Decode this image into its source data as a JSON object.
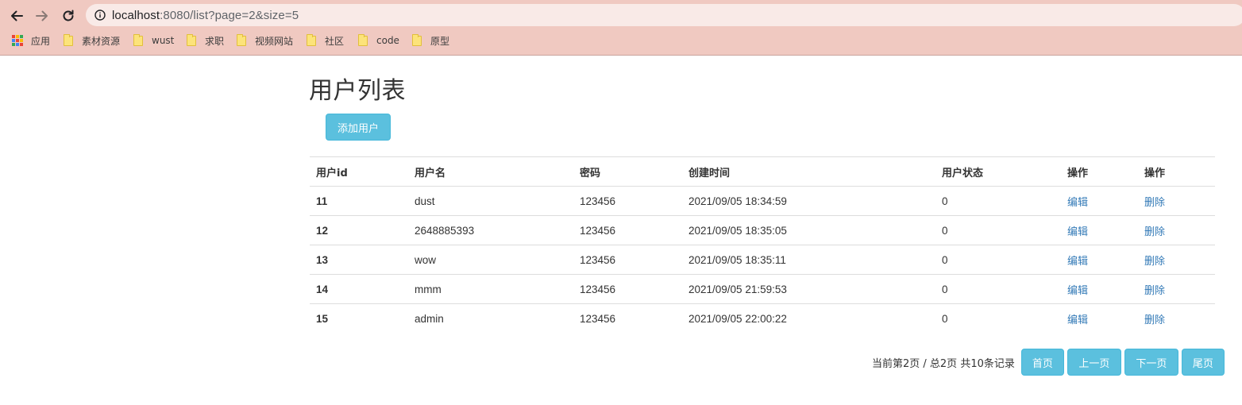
{
  "browser": {
    "url_host": "localhost",
    "url_path": ":8080/list?page=2&size=5",
    "bookmarks": [
      {
        "label": "应用",
        "icon": "apps-icon"
      },
      {
        "label": "素材资源",
        "icon": "folder-icon"
      },
      {
        "label": "wust",
        "icon": "folder-icon"
      },
      {
        "label": "求职",
        "icon": "folder-icon"
      },
      {
        "label": "视频网站",
        "icon": "folder-icon"
      },
      {
        "label": "社区",
        "icon": "folder-icon"
      },
      {
        "label": "code",
        "icon": "folder-icon"
      },
      {
        "label": "原型",
        "icon": "folder-icon"
      }
    ]
  },
  "page": {
    "title": "用户列表",
    "add_button": "添加用户"
  },
  "table": {
    "headers": [
      "用户id",
      "用户名",
      "密码",
      "创建时间",
      "用户状态",
      "操作",
      "操作"
    ],
    "rows": [
      {
        "id": "11",
        "username": "dust",
        "password": "123456",
        "created": "2021/09/05 18:34:59",
        "status": "0",
        "edit": "编辑",
        "delete": "删除"
      },
      {
        "id": "12",
        "username": "2648885393",
        "password": "123456",
        "created": "2021/09/05 18:35:05",
        "status": "0",
        "edit": "编辑",
        "delete": "删除"
      },
      {
        "id": "13",
        "username": "wow",
        "password": "123456",
        "created": "2021/09/05 18:35:11",
        "status": "0",
        "edit": "编辑",
        "delete": "删除"
      },
      {
        "id": "14",
        "username": "mmm",
        "password": "123456",
        "created": "2021/09/05 21:59:53",
        "status": "0",
        "edit": "编辑",
        "delete": "删除"
      },
      {
        "id": "15",
        "username": "admin",
        "password": "123456",
        "created": "2021/09/05 22:00:22",
        "status": "0",
        "edit": "编辑",
        "delete": "删除"
      }
    ]
  },
  "pagination": {
    "info": "当前第2页 / 总2页 共10条记录",
    "first": "首页",
    "prev": "上一页",
    "next": "下一页",
    "last": "尾页"
  },
  "colors": {
    "chrome_bg": "#f0c9c1",
    "accent_button": "#5bc0de",
    "link": "#337ab7"
  }
}
